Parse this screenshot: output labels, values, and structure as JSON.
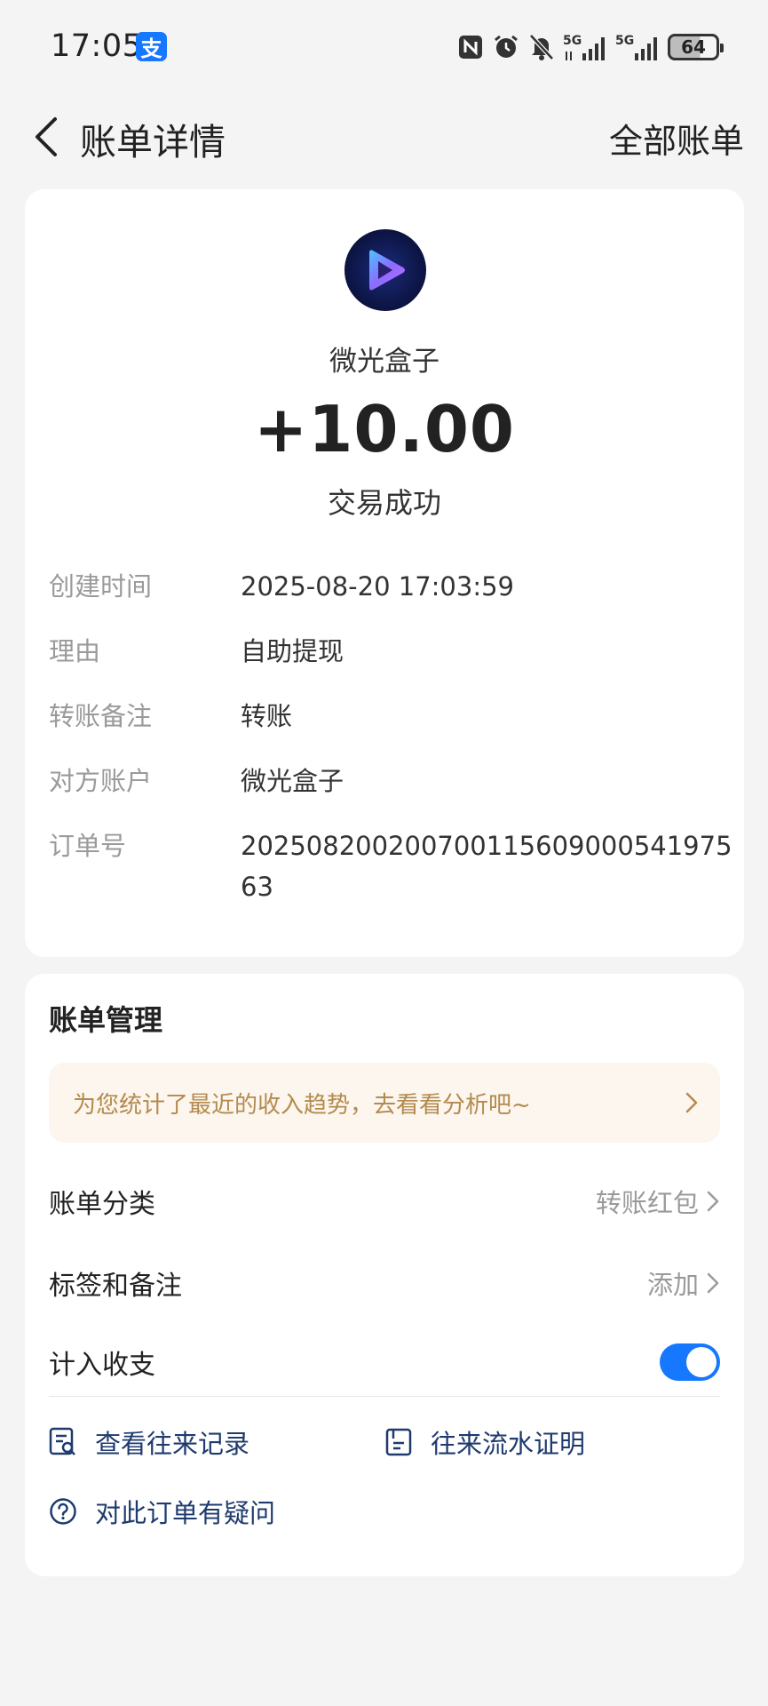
{
  "status_bar": {
    "time": "17:05",
    "app_badge": "支",
    "battery": "64",
    "network_label": "5G"
  },
  "nav": {
    "title": "账单详情",
    "right_action": "全部账单"
  },
  "transaction": {
    "merchant_name": "微光盒子",
    "amount": "+10.00",
    "status": "交易成功",
    "details": [
      {
        "label": "创建时间",
        "value": "2025-08-20 17:03:59"
      },
      {
        "label": "理由",
        "value": "自助提现"
      },
      {
        "label": "转账备注",
        "value": "转账"
      },
      {
        "label": "对方账户",
        "value": "微光盒子"
      },
      {
        "label": "订单号",
        "value": "20250820020070011560900054197563"
      }
    ]
  },
  "manage": {
    "title": "账单管理",
    "insight": "为您统计了最近的收入趋势，去看看分析吧~",
    "category_label": "账单分类",
    "category_value": "转账红包",
    "tags_label": "标签和备注",
    "tags_value": "添加",
    "count_label": "计入收支",
    "count_enabled": true,
    "links": {
      "history": "查看往来记录",
      "statement": "往来流水证明",
      "question": "对此订单有疑问"
    }
  },
  "colors": {
    "accent": "#1677ff",
    "link": "#1e3a6e",
    "insight": "#b48a4e",
    "background": "#f4f4f4"
  }
}
